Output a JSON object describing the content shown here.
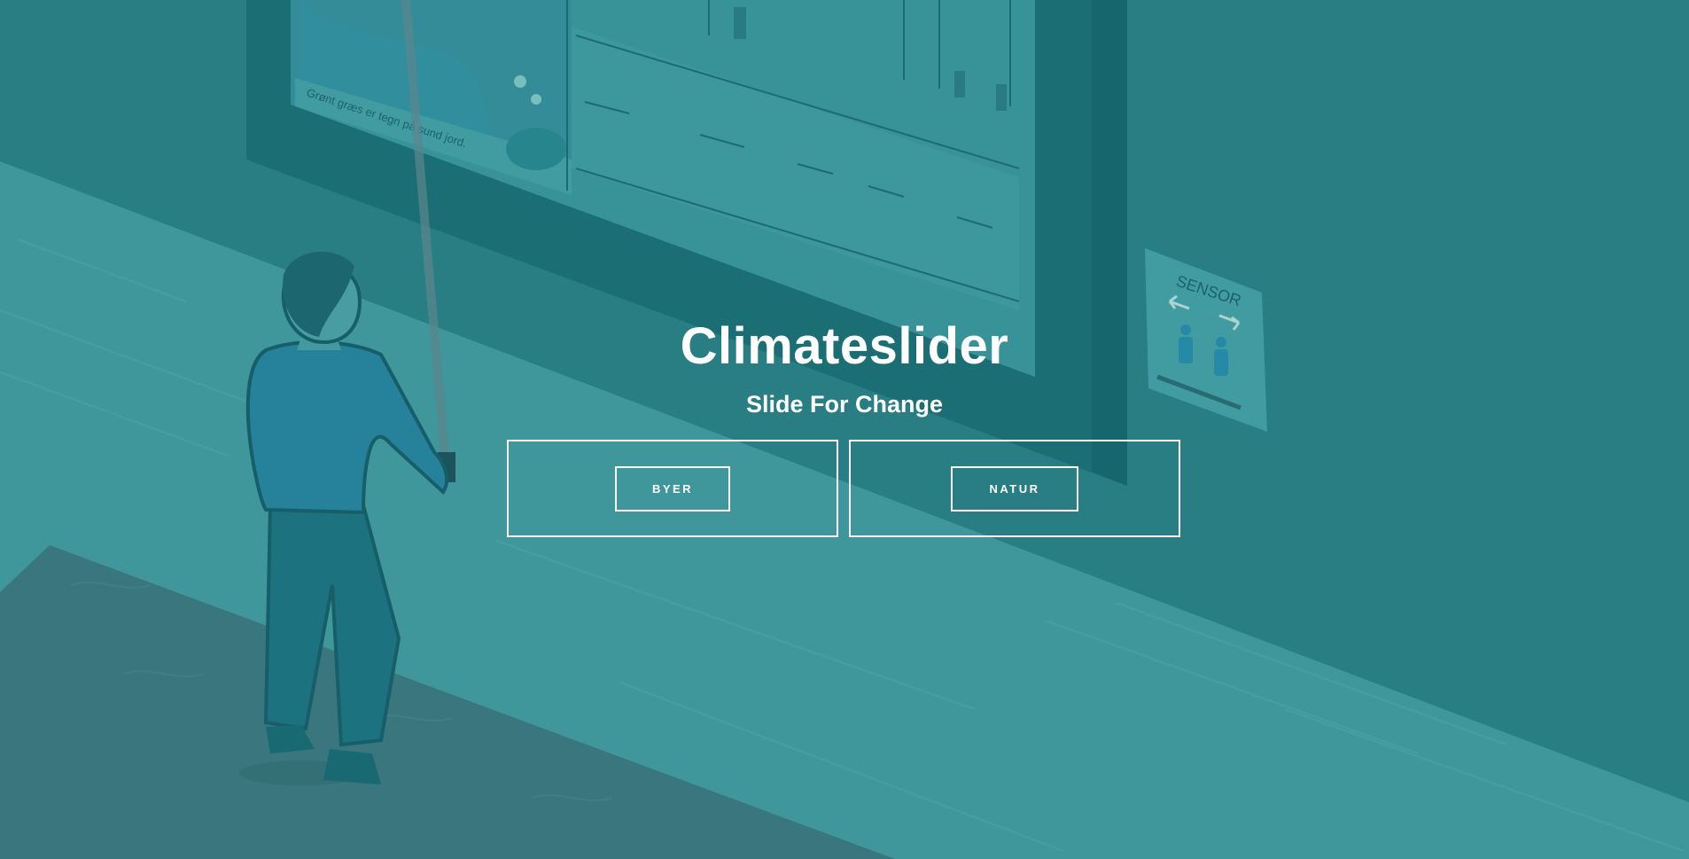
{
  "hero": {
    "title": "Climateslider",
    "subtitle": "Slide For Change"
  },
  "options": [
    {
      "label": "BYER"
    },
    {
      "label": "NATUR"
    }
  ],
  "illustration": {
    "sign_text": "SENSOR",
    "caption_text": "Grønt græs er tegn på sund jord."
  },
  "colors": {
    "background": "#2f8287",
    "floor": "#4aa0a4",
    "mat": "#427880",
    "frame": "#1f7379",
    "text": "#ffffff"
  }
}
